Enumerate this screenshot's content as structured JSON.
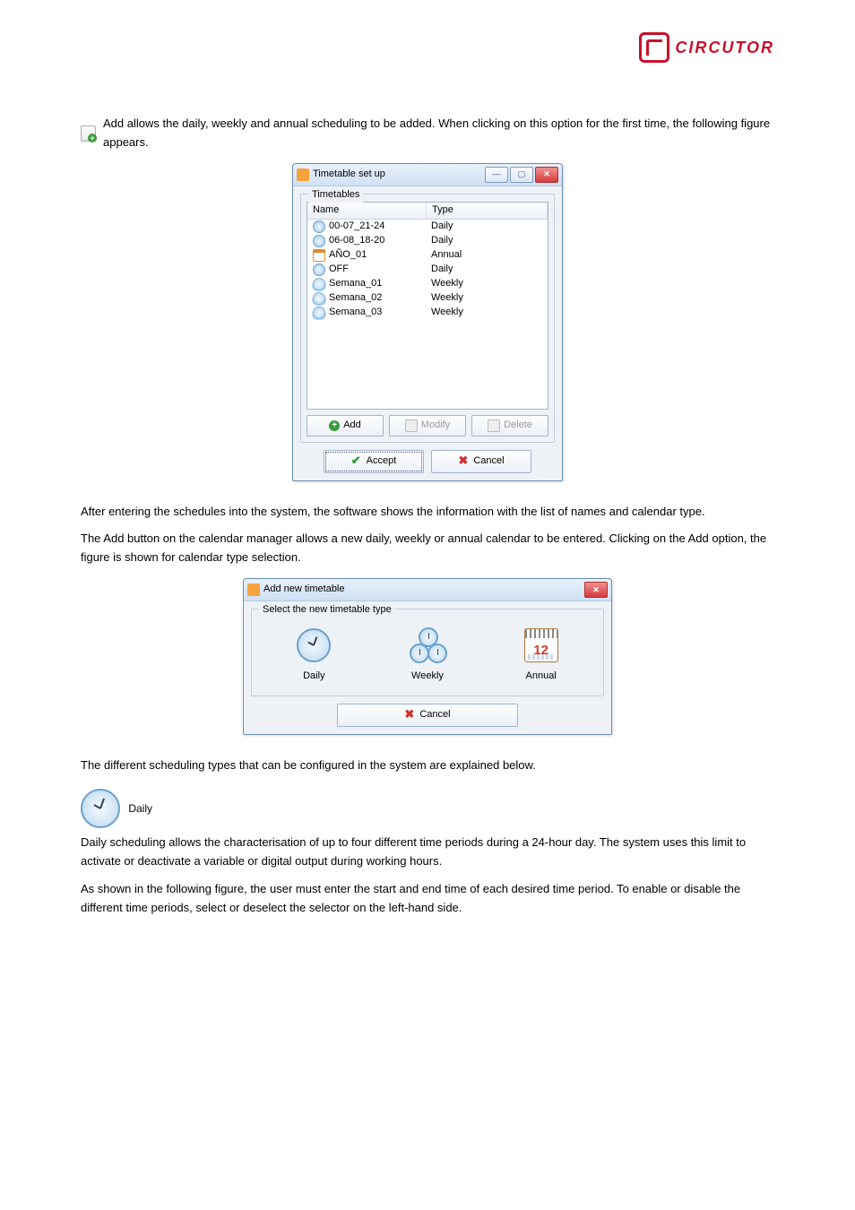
{
  "brand": "CIRCUTOR",
  "text": {
    "p1": "Add  allows  the  daily,  weekly  and  annual  scheduling  to  be  added.  When  clicking  on  this option for the first time, the following figure appears.",
    "p2": "After entering the schedules into the system, the software shows the information with the list of names and calendar type.",
    "p3": "The Add button on the calendar manager allows a new daily, weekly or annual calendar to be entered. Clicking on the Add option, the figure is shown for calendar type selection.",
    "p4": "The different scheduling types that can be configured in the system are explained below.",
    "daily_head": "Daily",
    "p5": "Daily scheduling allows the characterisation of up to four different time periods during a 24-hour day. The system uses this limit to activate or deactivate a variable or digital output during working hours.",
    "p6": "As shown in the following figure, the user must enter the start and end time of each desired time period. To enable or disable the different time periods, select or deselect the selector on the left-hand side."
  },
  "dlg1": {
    "title": "Timetable set up",
    "group": "Timetables",
    "cols": {
      "name": "Name",
      "type": "Type"
    },
    "rows": [
      {
        "name": "00-07_21-24",
        "type": "Daily"
      },
      {
        "name": "06-08_18-20",
        "type": "Daily"
      },
      {
        "name": "AÑO_01",
        "type": "Annual"
      },
      {
        "name": "OFF",
        "type": "Daily"
      },
      {
        "name": "Semana_01",
        "type": "Weekly"
      },
      {
        "name": "Semana_02",
        "type": "Weekly"
      },
      {
        "name": "Semana_03",
        "type": "Weekly"
      }
    ],
    "btn": {
      "add": "Add",
      "modify": "Modify",
      "delete": "Delete",
      "accept": "Accept",
      "cancel": "Cancel"
    }
  },
  "dlg2": {
    "title": "Add new timetable",
    "group": "Select the new timetable type",
    "opts": {
      "daily": "Daily",
      "weekly": "Weekly",
      "annual": "Annual"
    },
    "cal_num": "12",
    "cancel": "Cancel"
  }
}
